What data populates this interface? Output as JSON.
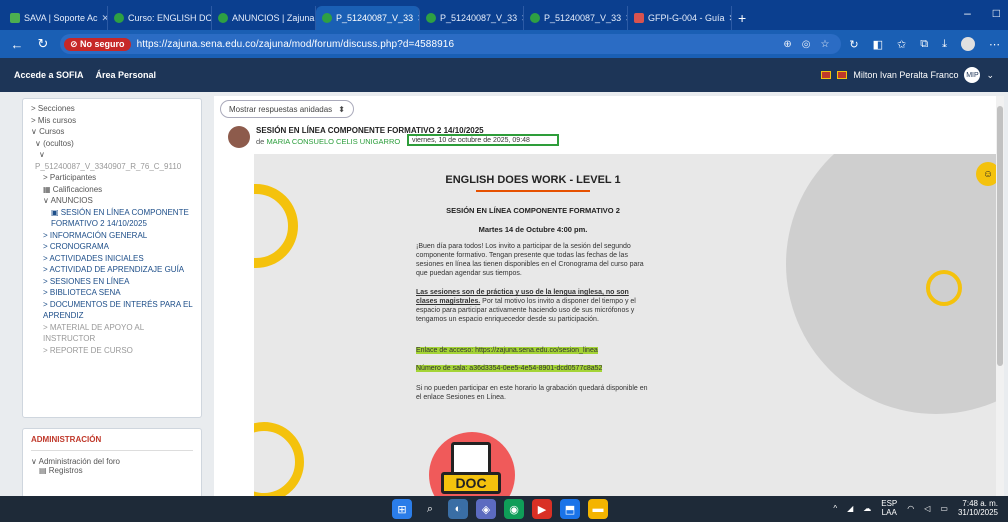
{
  "browser": {
    "tabs": [
      {
        "label": "SAVA | Soporte Ac",
        "icon": "sava-favicon"
      },
      {
        "label": "Curso: ENGLISH DO",
        "icon": "zajuna-favicon"
      },
      {
        "label": "ANUNCIOS | Zajuna",
        "icon": "zajuna-favicon"
      },
      {
        "label": "P_51240087_V_33",
        "icon": "zajuna-favicon",
        "active": true
      },
      {
        "label": "P_51240087_V_33",
        "icon": "zajuna-favicon"
      },
      {
        "label": "P_51240087_V_33",
        "icon": "zajuna-favicon"
      },
      {
        "label": "GFPI-G-004 - Guía",
        "icon": "doc-favicon"
      }
    ],
    "new_tab": "+",
    "insecure_label": "No seguro",
    "url": "https://zajuna.sena.edu.co/zajuna/mod/forum/discuss.php?d=4588916"
  },
  "appbar": {
    "link1": "Accede a SOFIA",
    "link2": "Área Personal",
    "user_name": "Milton Ivan Peralta Franco",
    "user_initials": "MIP"
  },
  "sidebar": {
    "items": [
      "> Secciones",
      "> Mis cursos",
      "∨ Cursos",
      "∨ (ocultos)",
      "∨",
      "P_51240087_V_3340907_R_76_C_9110",
      "> Participantes",
      "Calificaciones",
      "∨ ANUNCIOS",
      "SESIÓN EN LÍNEA COMPONENTE FORMATIVO 2 14/10/2025",
      "> INFORMACIÓN GENERAL",
      "> CRONOGRAMA",
      "> ACTIVIDADES INICIALES",
      "> ACTIVIDAD DE APRENDIZAJE GUÍA",
      "> SESIONES EN LÍNEA",
      "> BIBLIOTECA SENA",
      "> DOCUMENTOS DE INTERÉS PARA EL APRENDIZ",
      "> MATERIAL DE APOYO AL INSTRUCTOR",
      "> REPORTE DE CURSO"
    ]
  },
  "admin": {
    "header": "ADMINISTRACIÓN",
    "item1": "∨ Administración del foro",
    "item2": "Registros"
  },
  "post": {
    "display_mode": "Mostrar respuestas anidadas",
    "title": "SESIÓN EN LÍNEA COMPONENTE FORMATIVO 2 14/10/2025",
    "by_prefix": "de",
    "author": "MARIA CONSUELO CELIS UNIGARRO",
    "date": "viernes, 10 de octubre de 2025, 09:48"
  },
  "flyer": {
    "title": "ENGLISH DOES WORK - LEVEL 1",
    "subtitle": "SESIÓN EN LÍNEA COMPONENTE FORMATIVO 2",
    "date": "Martes 14 de Octubre 4:00 pm.",
    "p1": "¡Buen día para todos! Los invito a participar de la sesión del segundo componente formativo. Tengan presente que todas las fechas de las sesiones en línea las tienen disponibles en el Cronograma del curso para que puedan agendar sus tiempos.",
    "p2_bold": "Las sesiones son de práctica y uso de la lengua inglesa, no son clases magistrales.",
    "p2_rest": " Por tal motivo los invito a disponer del tiempo y el espacio para participar activamente haciendo uso de sus micrófonos y tengamos un espacio enriquecedor desde su participación.",
    "link": "Enlace de acceso: https://zajuna.sena.edu.co/sesion_linea",
    "room": "Número de sala: a36d3354-0ee5-4e54-8901-dcd0577c8a52",
    "p3": "Si no pueden participar en este horario la grabación quedará disponible en el enlace Sesiones en Línea.",
    "doc_label": "DOC"
  },
  "taskbar": {
    "lang1": "ESP",
    "lang2": "LAA",
    "time": "7:48 a. m.",
    "date": "31/10/2025"
  }
}
